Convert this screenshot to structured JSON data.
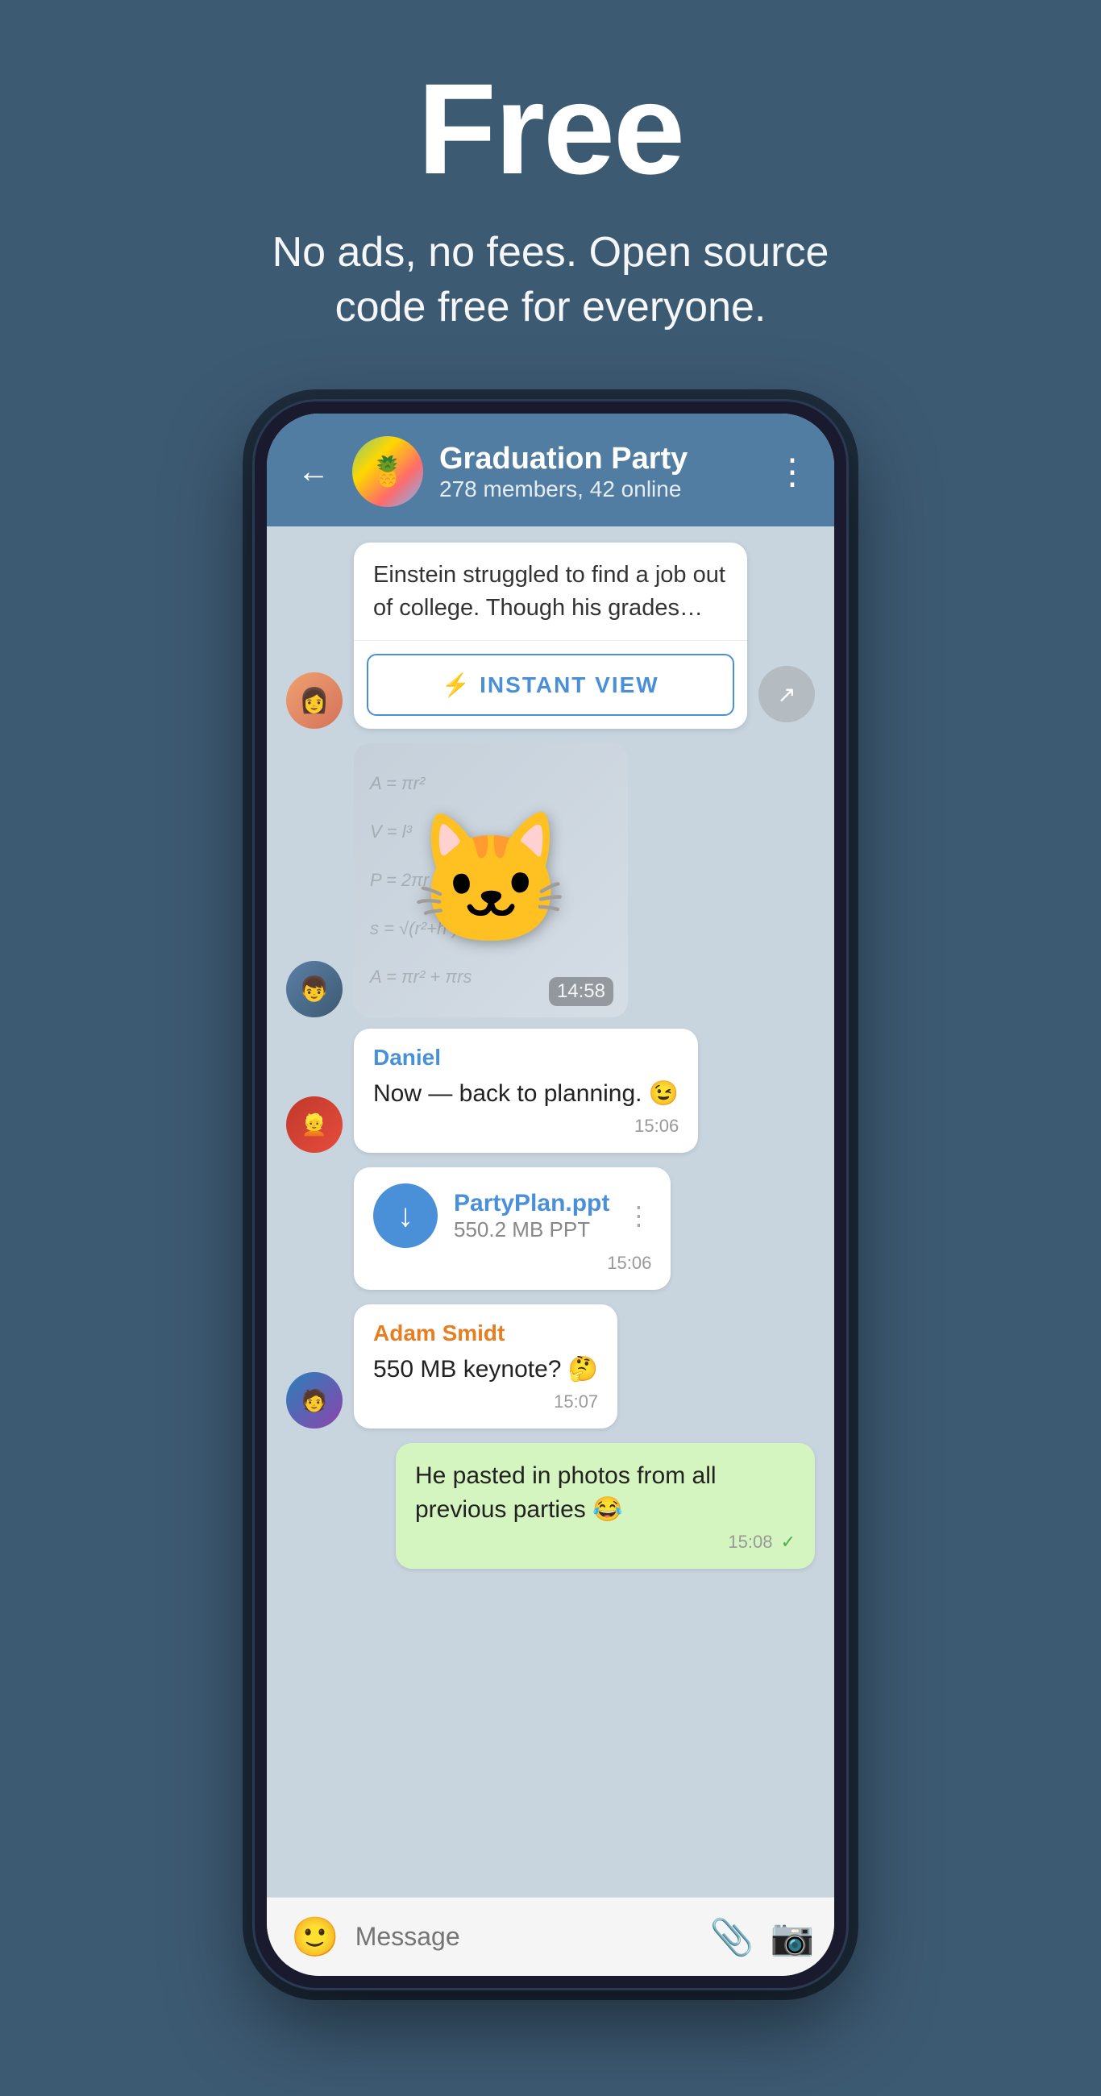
{
  "hero": {
    "title": "Free",
    "subtitle": "No ads, no fees. Open source\ncode free for everyone."
  },
  "phone": {
    "header": {
      "chat_name": "Graduation Party",
      "chat_status": "278 members, 42 online",
      "back_label": "←",
      "menu_label": "⋮"
    },
    "messages": [
      {
        "id": "msg1",
        "type": "incoming_iv",
        "sender": "girl",
        "text": "Einstein struggled to find a job out of college. Though his grades...",
        "iv_button": "INSTANT VIEW",
        "has_share": true
      },
      {
        "id": "msg2",
        "type": "sticker",
        "sender": "boy",
        "time": "14:58"
      },
      {
        "id": "msg3",
        "type": "incoming",
        "sender": "daniel",
        "sender_name": "Daniel",
        "text": "Now — back to planning. 😉",
        "time": "15:06"
      },
      {
        "id": "msg4",
        "type": "file",
        "sender": "daniel",
        "file_name": "PartyPlan.ppt",
        "file_size": "550.2 MB PPT",
        "time": "15:06"
      },
      {
        "id": "msg5",
        "type": "incoming",
        "sender": "adam",
        "sender_name": "Adam Smidt",
        "text": "550 MB keynote? 🤔",
        "time": "15:07"
      },
      {
        "id": "msg6",
        "type": "outgoing",
        "text": "He pasted in photos from all previous parties 😂",
        "time": "15:08",
        "delivered": true
      }
    ],
    "input": {
      "placeholder": "Message",
      "emoji_icon": "😊",
      "attach_icon": "📎",
      "camera_icon": "📷"
    }
  },
  "icons": {
    "lightning": "⚡",
    "back_arrow": "←",
    "more_vert": "⋮",
    "download": "↓",
    "share": "↗",
    "check": "✓",
    "check_double": "✓"
  }
}
